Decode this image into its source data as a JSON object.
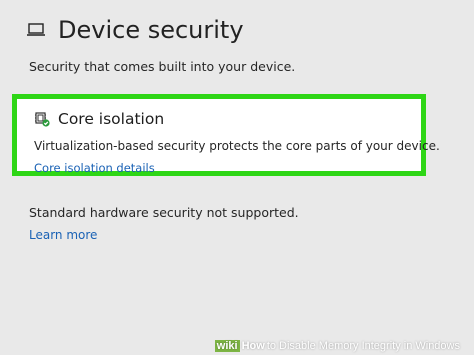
{
  "header": {
    "title": "Device security",
    "icon": "laptop-icon"
  },
  "subtitle": "Security that comes built into your device.",
  "core_isolation": {
    "icon": "core-isolation-icon",
    "title": "Core isolation",
    "description": "Virtualization-based security protects the core parts of your device.",
    "link_label": "Core isolation details",
    "highlight_color": "#2ed616"
  },
  "hardware": {
    "status_text": "Standard hardware security not supported.",
    "link_label": "Learn more"
  },
  "watermark": {
    "brand_wiki": "wiki",
    "brand_how": "How",
    "caption": "to Disable Memory Integrity in Windows"
  },
  "colors": {
    "background": "#e9e9e9",
    "link": "#1a62b5",
    "highlight": "#2ed616"
  }
}
